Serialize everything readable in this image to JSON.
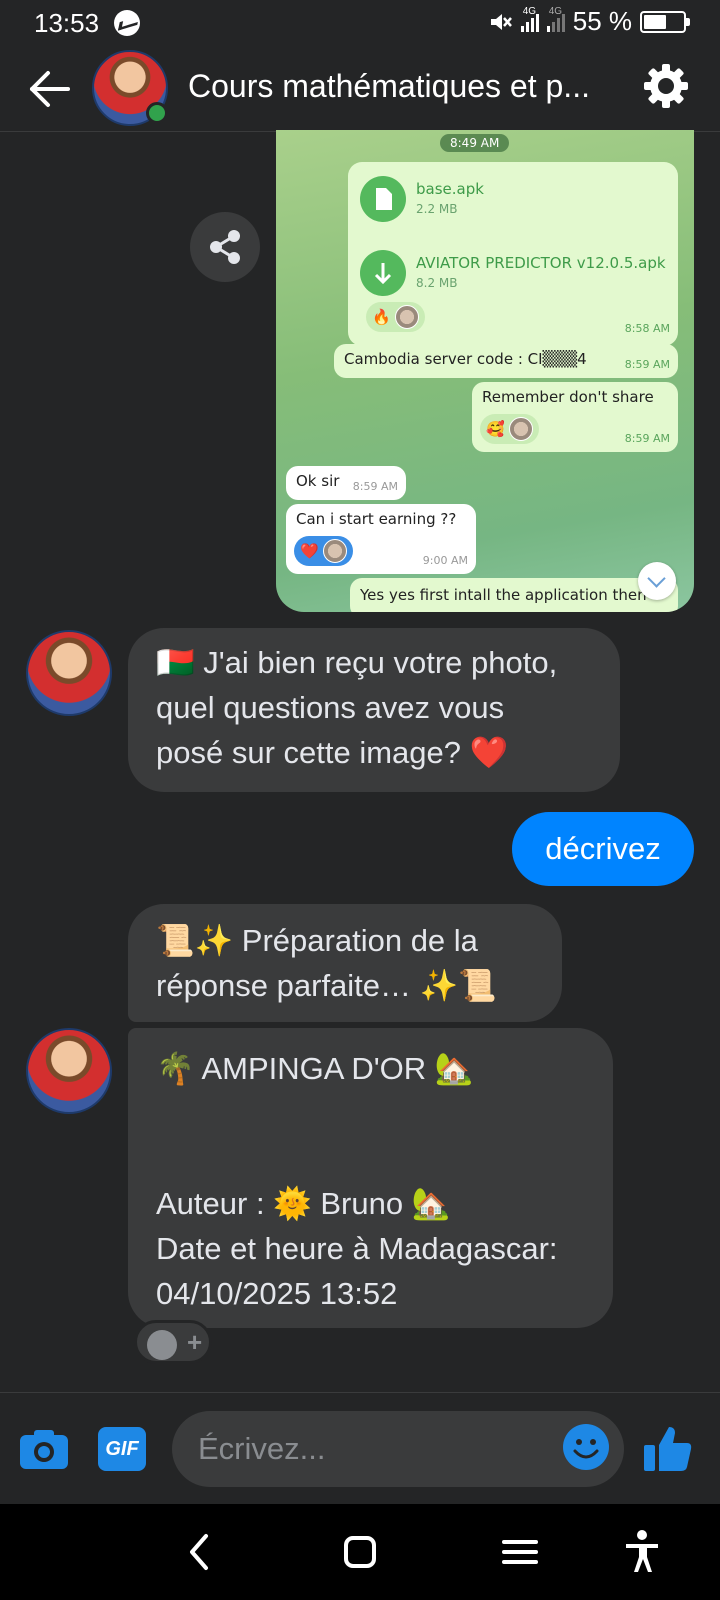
{
  "status_bar": {
    "time": "13:53",
    "network_1": "4G",
    "network_2": "4G",
    "battery_percent": "55 %"
  },
  "header": {
    "title": "Cours mathématiques et p...",
    "online": true
  },
  "image_message": {
    "date_chip": "8:49 AM",
    "files": [
      {
        "name": "base.apk",
        "size": "2.2 MB"
      },
      {
        "name": "AVIATOR PREDICTOR v12.0.5.apk",
        "size": "8.2 MB"
      }
    ],
    "files_reaction": "🔥",
    "files_time": "8:58 AM",
    "messages": [
      {
        "dir": "out",
        "text": "Cambodia server code : CI▒▒▒4",
        "time": "8:59 AM"
      },
      {
        "dir": "out",
        "text": "Remember don't share",
        "reaction": "🥰",
        "time": "8:59 AM"
      },
      {
        "dir": "in",
        "text": "Ok sir",
        "time": "8:59 AM"
      },
      {
        "dir": "in",
        "text": "Can i start earning ??",
        "reaction": "❤️",
        "time": "9:00 AM"
      },
      {
        "dir": "out",
        "text": "Yes yes first intall the application then"
      }
    ]
  },
  "conversation": {
    "bubble1_lines": [
      "🇲🇬 J'ai bien reçu votre photo,",
      "quel questions avez vous",
      "posé sur cette image? ❤️"
    ],
    "outgoing": "décrivez",
    "bubble2_lines": [
      "📜✨ Préparation de la",
      "réponse parfaite… ✨📜"
    ],
    "bubble3_lines": [
      "🌴 AMPINGA D'OR 🏡",
      "Auteur : 🌞 Bruno 🏡",
      "Date et heure à Madagascar:",
      "04/10/2025 13:52"
    ]
  },
  "input_bar": {
    "placeholder": "Écrivez...",
    "gif_label": "GIF"
  },
  "colors": {
    "background": "#242526",
    "bubble": "#3a3b3c",
    "outgoing_bubble": "#0084ff",
    "accent": "#1e88e5"
  },
  "icons": [
    "messenger-icon",
    "mute-icon",
    "signal-icon",
    "battery-icon",
    "back-arrow-icon",
    "gear-icon",
    "share-icon",
    "camera-icon",
    "gif-icon",
    "emoji-icon",
    "thumbs-up-icon",
    "nav-back-icon",
    "nav-home-icon",
    "nav-recents-icon",
    "accessibility-icon"
  ]
}
